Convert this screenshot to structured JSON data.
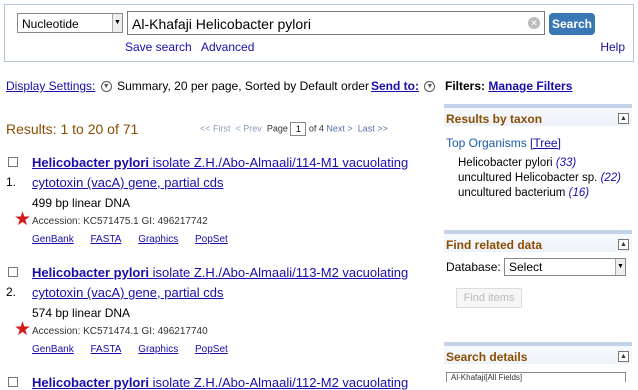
{
  "search": {
    "database": "Nucleotide",
    "query": "Al-Khafaji Helicobacter pylori",
    "button": "Search",
    "save_search": "Save search",
    "advanced": "Advanced",
    "help": "Help"
  },
  "display": {
    "settings_label": "Display Settings:",
    "settings_value": "Summary, 20 per page, Sorted by Default order",
    "send_to": "Send to:"
  },
  "results": {
    "header": "Results: 1 to 20 of 71",
    "pager": {
      "first": "<< First",
      "prev": "< Prev",
      "page_label": "Page",
      "page_value": "1",
      "of": "of 4",
      "next": "Next >",
      "last": "Last >>"
    },
    "items": [
      {
        "number": "1.",
        "title_bold": "Helicobacter pylori",
        "title_rest": " isolate Z.H./Abo-Almaali/114-M1 vacuolating cytotoxin (vacA) gene, partial cds",
        "desc": "499 bp linear DNA",
        "accession": "Accession: KC571475.1   GI: 496217742",
        "links": [
          "GenBank",
          "FASTA",
          "Graphics",
          "PopSet"
        ]
      },
      {
        "number": "2.",
        "title_bold": "Helicobacter pylori",
        "title_rest": " isolate Z.H./Abo-Almaali/113-M2 vacuolating cytotoxin (vacA) gene, partial cds",
        "desc": "574 bp linear DNA",
        "accession": "Accession: KC571474.1   GI: 496217740",
        "links": [
          "GenBank",
          "FASTA",
          "Graphics",
          "PopSet"
        ]
      },
      {
        "number": "",
        "title_bold": "Helicobacter pylori",
        "title_rest": " isolate Z.H./Abo-Almaali/112-M2 vacuolating",
        "desc": "",
        "accession": "",
        "links": []
      }
    ]
  },
  "sidebar": {
    "filters_label": "Filters:",
    "manage_filters": "Manage Filters",
    "taxon": {
      "title": "Results by taxon",
      "top_label": "Top Organisms",
      "tree": "[Tree]",
      "organisms": [
        {
          "name": "Helicobacter pylori",
          "count": "(33)"
        },
        {
          "name": "uncultured Helicobacter sp.",
          "count": "(22)"
        },
        {
          "name": "uncultured bacterium",
          "count": "(16)"
        }
      ]
    },
    "related": {
      "title": "Find related data",
      "database_label": "Database:",
      "database_value": "Select",
      "find_button": "Find items"
    },
    "details": {
      "title": "Search details",
      "query_preview": "Al-Khafaji[All Fields]"
    }
  },
  "icons": {
    "star_color": "#d11a1a",
    "accent": "#3a78b5",
    "results_header_color": "#8b4d00"
  }
}
